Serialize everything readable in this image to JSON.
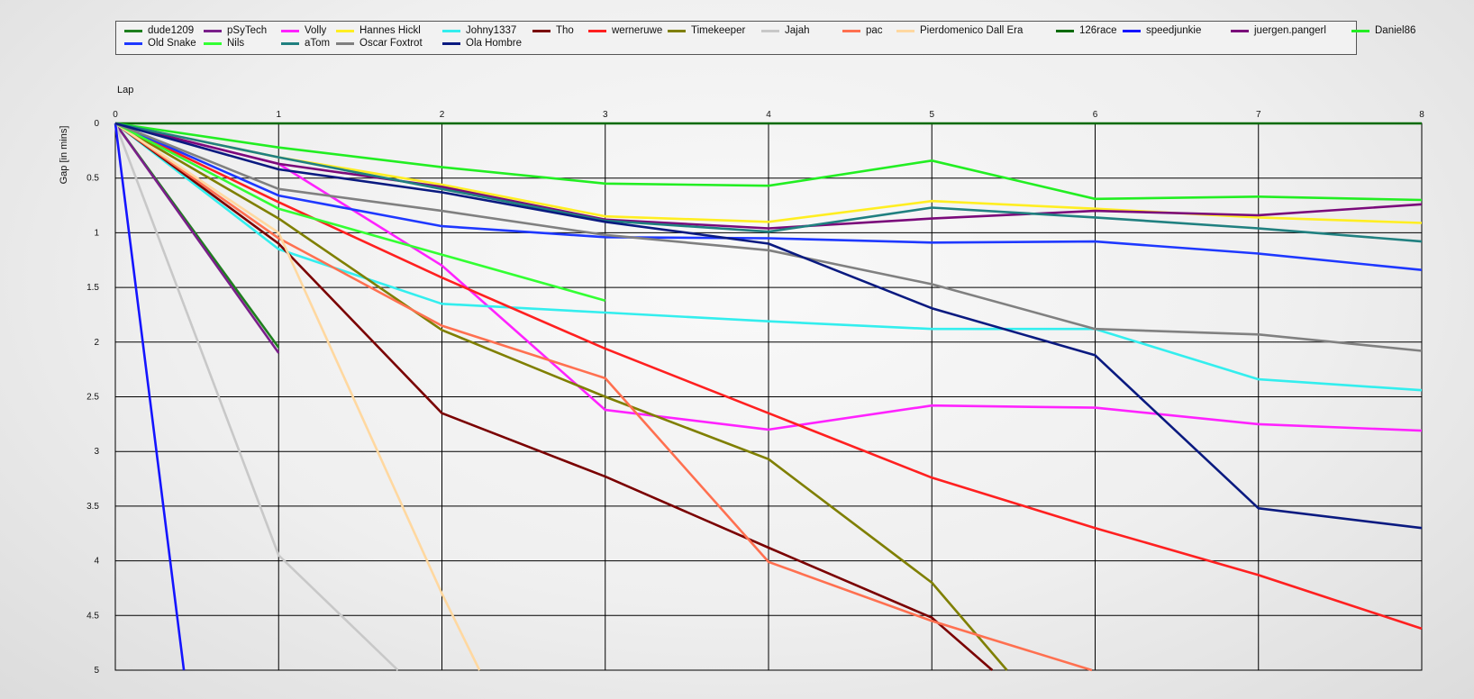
{
  "chart_data": {
    "type": "line",
    "xlabel": "Lap",
    "ylabel": "Gap [in mins]",
    "xlim": [
      0,
      8
    ],
    "ylim": [
      0,
      5
    ],
    "y_inverted": true,
    "grid": true,
    "legend_position": "top",
    "xticks": [
      "0",
      "1",
      "2",
      "3",
      "4",
      "5",
      "6",
      "7",
      "8"
    ],
    "yticks": [
      "0",
      "0.5",
      "1",
      "1.5",
      "2",
      "2.5",
      "3",
      "3.5",
      "4",
      "4.5",
      "5"
    ],
    "series": [
      {
        "name": "dude1209",
        "color": "#1e7f1e",
        "x": [
          0,
          1
        ],
        "y": [
          0,
          2.05
        ]
      },
      {
        "name": "pSyTech",
        "color": "#7a1f8a",
        "x": [
          0,
          1
        ],
        "y": [
          0,
          2.1
        ]
      },
      {
        "name": "Volly",
        "color": "#ff22ff",
        "x": [
          0,
          1,
          2,
          3,
          4,
          5,
          6,
          7,
          8
        ],
        "y": [
          0,
          0.37,
          1.3,
          2.62,
          2.8,
          2.58,
          2.6,
          2.75,
          2.81
        ]
      },
      {
        "name": "Hannes Hickl",
        "color": "#ffee22",
        "x": [
          0,
          1,
          2,
          3,
          4,
          5,
          6,
          7,
          8
        ],
        "y": [
          0,
          0.31,
          0.56,
          0.85,
          0.9,
          0.71,
          0.78,
          0.86,
          0.91
        ]
      },
      {
        "name": "Johny1337",
        "color": "#33eeee",
        "x": [
          0,
          1,
          2,
          3,
          4,
          5,
          6,
          7,
          8
        ],
        "y": [
          0,
          1.15,
          1.65,
          1.73,
          1.81,
          1.88,
          1.88,
          2.34,
          2.44
        ]
      },
      {
        "name": "Tho",
        "color": "#7a0000",
        "x": [
          0,
          1,
          2,
          3,
          4,
          5,
          5.37
        ],
        "y": [
          0,
          1.1,
          2.65,
          3.23,
          3.88,
          4.52,
          5
        ]
      },
      {
        "name": "werneruwe",
        "color": "#ff2020",
        "x": [
          0,
          1,
          2,
          3,
          4,
          5,
          6,
          7,
          8
        ],
        "y": [
          0,
          0.72,
          1.41,
          2.06,
          2.65,
          3.24,
          3.7,
          4.13,
          4.62
        ]
      },
      {
        "name": "Timekeeper",
        "color": "#7f7f00",
        "x": [
          0,
          1,
          2,
          3,
          4,
          5,
          5.46
        ],
        "y": [
          0,
          0.87,
          1.89,
          2.5,
          3.07,
          4.2,
          5
        ]
      },
      {
        "name": "Jajah",
        "color": "#c8c8c8",
        "x": [
          0,
          1,
          1.73
        ],
        "y": [
          0,
          3.95,
          5
        ]
      },
      {
        "name": "pac",
        "color": "#ff7050",
        "x": [
          0,
          1,
          2,
          3,
          4,
          5,
          5.98
        ],
        "y": [
          0,
          1.05,
          1.85,
          2.33,
          4.01,
          4.55,
          5
        ]
      },
      {
        "name": "Pierdomenico Dall Era",
        "color": "#ffd8a0",
        "x": [
          0,
          1,
          2,
          2.23
        ],
        "y": [
          0,
          1.0,
          4.3,
          5
        ]
      },
      {
        "name": "126race",
        "color": "#006a00",
        "x": [
          0,
          8
        ],
        "y": [
          0,
          0
        ]
      },
      {
        "name": "speedjunkie",
        "color": "#1414ff",
        "x": [
          0,
          0.42
        ],
        "y": [
          0,
          5
        ]
      },
      {
        "name": "juergen.pangerl",
        "color": "#7a0a7a",
        "x": [
          0,
          1,
          2,
          3,
          4,
          5,
          6,
          7,
          8
        ],
        "y": [
          0,
          0.37,
          0.58,
          0.88,
          0.96,
          0.87,
          0.8,
          0.84,
          0.74
        ]
      },
      {
        "name": "Daniel86",
        "color": "#22ee22",
        "x": [
          0,
          1,
          2,
          3,
          4,
          5,
          6,
          7,
          8
        ],
        "y": [
          0,
          0.22,
          0.4,
          0.55,
          0.57,
          0.34,
          0.69,
          0.67,
          0.7
        ]
      },
      {
        "name": "Old Snake",
        "color": "#1e38ff",
        "x": [
          0,
          1,
          2,
          3,
          4,
          5,
          6,
          7,
          8
        ],
        "y": [
          0,
          0.66,
          0.94,
          1.04,
          1.05,
          1.09,
          1.08,
          1.19,
          1.34
        ]
      },
      {
        "name": "Nils",
        "color": "#33ff33",
        "x": [
          0,
          1,
          2,
          3
        ],
        "y": [
          0,
          0.78,
          1.2,
          1.62
        ]
      },
      {
        "name": "aTom",
        "color": "#208080",
        "x": [
          0,
          1,
          2,
          3,
          4,
          5,
          6,
          7,
          8
        ],
        "y": [
          0,
          0.31,
          0.6,
          0.89,
          0.99,
          0.77,
          0.86,
          0.96,
          1.08
        ]
      },
      {
        "name": "Oscar Foxtrot",
        "color": "#808080",
        "x": [
          0,
          1,
          2,
          3,
          4,
          5,
          6,
          7,
          8
        ],
        "y": [
          0,
          0.6,
          0.8,
          1.02,
          1.16,
          1.47,
          1.88,
          1.93,
          2.08
        ]
      },
      {
        "name": "Ola Hombre",
        "color": "#0a1a80",
        "x": [
          0,
          1,
          2,
          3,
          4,
          5,
          6,
          7,
          8
        ],
        "y": [
          0,
          0.42,
          0.63,
          0.9,
          1.1,
          1.69,
          2.12,
          3.52,
          3.7
        ]
      }
    ]
  }
}
